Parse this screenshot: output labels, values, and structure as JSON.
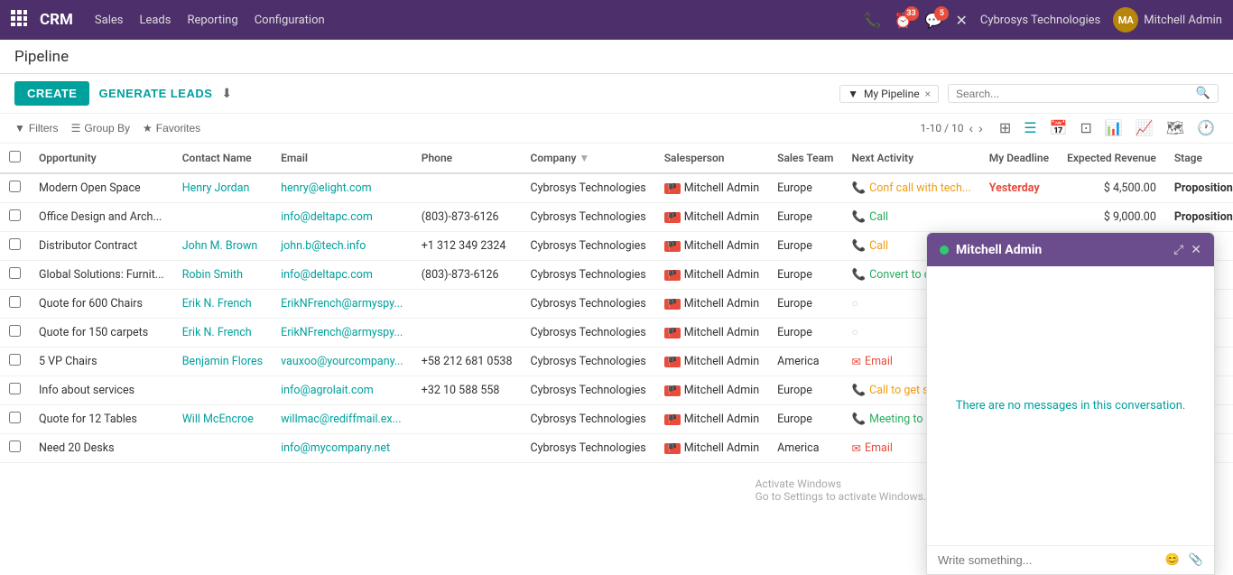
{
  "app": {
    "name": "CRM"
  },
  "topnav": {
    "brand": "CRM",
    "menu": [
      "Sales",
      "Leads",
      "Reporting",
      "Configuration"
    ],
    "notifications": {
      "activity_count": "33",
      "message_count": "5"
    },
    "company": "Cybrosys Technologies",
    "user": "Mitchell Admin"
  },
  "page": {
    "title": "Pipeline"
  },
  "toolbar": {
    "create_label": "CREATE",
    "generate_label": "GENERATE LEADS",
    "download_icon": "⬇"
  },
  "filter": {
    "label": "My Pipeline",
    "close": "×"
  },
  "search": {
    "placeholder": "Search..."
  },
  "view_controls": {
    "filters_label": "Filters",
    "group_by_label": "Group By",
    "favorites_label": "Favorites",
    "pagination": "1-10 / 10"
  },
  "table": {
    "columns": [
      "",
      "Opportunity",
      "Contact Name",
      "Email",
      "Phone",
      "Company",
      "Salesperson",
      "Sales Team",
      "Next Activity",
      "My Deadline",
      "Expected Revenue",
      "Stage",
      ""
    ],
    "rows": [
      {
        "id": 1,
        "opportunity": "Modern Open Space",
        "contact": "Henry Jordan",
        "email": "henry@elight.com",
        "phone": "",
        "company": "Cybrosys Technologies",
        "salesperson": "Mitchell Admin",
        "sales_team": "Europe",
        "next_activity": "Conf call with tech...",
        "next_activity_type": "phone",
        "my_deadline": "Yesterday",
        "my_deadline_class": "red",
        "expected_revenue": "$ 4,500.00",
        "stage": "Proposition"
      },
      {
        "id": 2,
        "opportunity": "Office Design and Arch...",
        "contact": "",
        "email": "info@deltapc.com",
        "phone": "(803)-873-6126",
        "company": "Cybrosys Technologies",
        "salesperson": "Mitchell Admin",
        "sales_team": "Europe",
        "next_activity": "Call",
        "next_activity_type": "call",
        "my_deadline": "",
        "my_deadline_class": "",
        "expected_revenue": "$ 9,000.00",
        "stage": "Proposition"
      },
      {
        "id": 3,
        "opportunity": "Distributor Contract",
        "contact": "John M. Brown",
        "email": "john.b@tech.info",
        "phone": "+1 312 349 2324",
        "company": "Cybrosys Technologies",
        "salesperson": "Mitchell Admin",
        "sales_team": "Europe",
        "next_activity": "Call",
        "next_activity_type": "call_yellow",
        "my_deadline": "",
        "my_deadline_class": "",
        "expected_revenue": "",
        "stage": ""
      },
      {
        "id": 4,
        "opportunity": "Global Solutions: Furnit...",
        "contact": "Robin Smith",
        "email": "info@deltapc.com",
        "phone": "(803)-873-6126",
        "company": "Cybrosys Technologies",
        "salesperson": "Mitchell Admin",
        "sales_team": "Europe",
        "next_activity": "Convert to quote",
        "next_activity_type": "call",
        "my_deadline": "",
        "my_deadline_class": "",
        "expected_revenue": "",
        "stage": ""
      },
      {
        "id": 5,
        "opportunity": "Quote for 600 Chairs",
        "contact": "Erik N. French",
        "email": "ErikNFrench@armyspy...",
        "phone": "",
        "company": "Cybrosys Technologies",
        "salesperson": "Mitchell Admin",
        "sales_team": "Europe",
        "next_activity": "",
        "next_activity_type": "none",
        "my_deadline": "",
        "my_deadline_class": "",
        "expected_revenue": "",
        "stage": ""
      },
      {
        "id": 6,
        "opportunity": "Quote for 150 carpets",
        "contact": "Erik N. French",
        "email": "ErikNFrench@armyspy...",
        "phone": "",
        "company": "Cybrosys Technologies",
        "salesperson": "Mitchell Admin",
        "sales_team": "Europe",
        "next_activity": "",
        "next_activity_type": "none",
        "my_deadline": "",
        "my_deadline_class": "",
        "expected_revenue": "",
        "stage": ""
      },
      {
        "id": 7,
        "opportunity": "5 VP Chairs",
        "contact": "Benjamin Flores",
        "email": "vauxoo@yourcompany...",
        "phone": "+58 212 681 0538",
        "company": "Cybrosys Technologies",
        "salesperson": "Mitchell Admin",
        "sales_team": "America",
        "next_activity": "Email",
        "next_activity_type": "email",
        "my_deadline": "",
        "my_deadline_class": "",
        "expected_revenue": "",
        "stage": ""
      },
      {
        "id": 8,
        "opportunity": "Info about services",
        "contact": "",
        "email": "info@agrolait.com",
        "phone": "+32 10 588 558",
        "company": "Cybrosys Technologies",
        "salesperson": "Mitchell Admin",
        "sales_team": "Europe",
        "next_activity": "Call to get syste",
        "next_activity_type": "call_yellow",
        "my_deadline": "",
        "my_deadline_class": "",
        "expected_revenue": "",
        "stage": ""
      },
      {
        "id": 9,
        "opportunity": "Quote for 12 Tables",
        "contact": "Will McEncroe",
        "email": "willmac@rediffmail.ex...",
        "phone": "",
        "company": "Cybrosys Technologies",
        "salesperson": "Mitchell Admin",
        "sales_team": "Europe",
        "next_activity": "Meeting to go ov",
        "next_activity_type": "meeting",
        "my_deadline": "",
        "my_deadline_class": "",
        "expected_revenue": "",
        "stage": ""
      },
      {
        "id": 10,
        "opportunity": "Need 20 Desks",
        "contact": "",
        "email": "info@mycompany.net",
        "phone": "",
        "company": "Cybrosys Technologies",
        "salesperson": "Mitchell Admin",
        "sales_team": "America",
        "next_activity": "Email",
        "next_activity_type": "email",
        "my_deadline": "",
        "my_deadline_class": "",
        "expected_revenue": "",
        "stage": ""
      }
    ]
  },
  "chat": {
    "title": "Mitchell Admin",
    "empty_message": "There are no messages in this conversation.",
    "input_placeholder": "Write something...",
    "status": "online"
  },
  "activate_windows": {
    "line1": "Activate Windows",
    "line2": "Go to Settings to activate Windows."
  }
}
